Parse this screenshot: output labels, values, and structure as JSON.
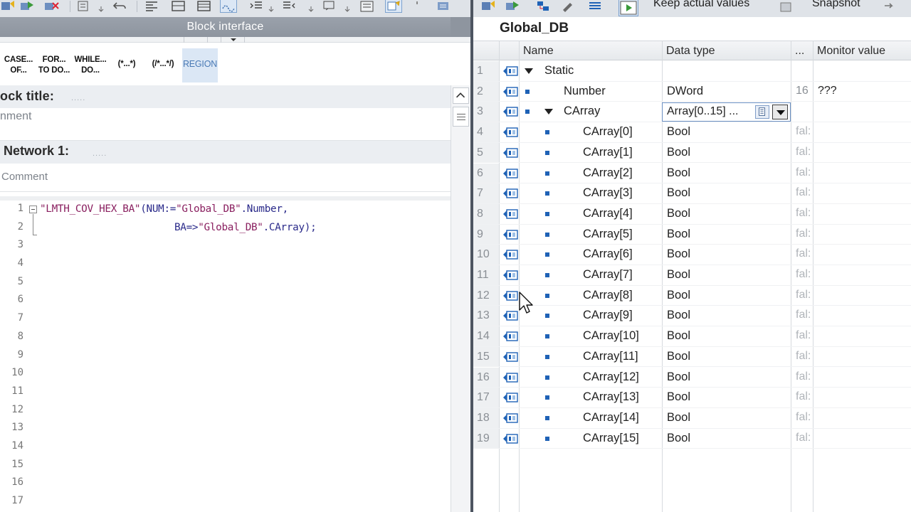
{
  "left_pane": {
    "block_interface_label": "Block interface",
    "instructions": [
      {
        "line1": "CASE...",
        "line2": "OF..."
      },
      {
        "line1": "FOR...",
        "line2": "TO DO..."
      },
      {
        "line1": "WHILE...",
        "line2": "DO..."
      },
      {
        "line1": "(*...*)",
        "line2": ""
      },
      {
        "line1": "(/*...*/)",
        "line2": ""
      },
      {
        "line1": "REGION",
        "line2": ""
      }
    ],
    "block_title_label": "ock title:",
    "block_title_dots": ".....",
    "block_comment_placeholder": "nment",
    "network_label": "Network 1:",
    "network_dots": ".....",
    "network_comment_placeholder": "Comment",
    "code_lines": [
      {
        "num": "1",
        "segments": [
          {
            "text": "\"LMTH_COV_HEX_BA\"",
            "kind": "str"
          },
          {
            "text": "(NUM:=",
            "kind": "op"
          },
          {
            "text": "\"Global_DB\"",
            "kind": "str"
          },
          {
            "text": ".Number,",
            "kind": "op"
          }
        ]
      },
      {
        "num": "2",
        "segments": [
          {
            "text": "BA=>",
            "kind": "op"
          },
          {
            "text": "\"Global_DB\"",
            "kind": "str"
          },
          {
            "text": ".CArray);",
            "kind": "op"
          }
        ]
      },
      {
        "num": "3",
        "segments": []
      },
      {
        "num": "4",
        "segments": []
      },
      {
        "num": "5",
        "segments": []
      },
      {
        "num": "6",
        "segments": []
      },
      {
        "num": "7",
        "segments": []
      },
      {
        "num": "8",
        "segments": []
      },
      {
        "num": "9",
        "segments": []
      },
      {
        "num": "10",
        "segments": []
      },
      {
        "num": "11",
        "segments": []
      },
      {
        "num": "12",
        "segments": []
      },
      {
        "num": "13",
        "segments": []
      },
      {
        "num": "14",
        "segments": []
      },
      {
        "num": "15",
        "segments": []
      },
      {
        "num": "16",
        "segments": []
      },
      {
        "num": "17",
        "segments": []
      }
    ]
  },
  "right_pane": {
    "toolbar": {
      "keep_actual_values": "Keep actual values",
      "snapshot": "Snapshot"
    },
    "db_title": "Global_DB",
    "columns": {
      "name": "Name",
      "data_type": "Data type",
      "ellipsis": "...",
      "monitor_value": "Monitor value"
    },
    "rows": [
      {
        "num": "1",
        "name": "Static",
        "indent": 0,
        "expander": true,
        "bullet": false,
        "data_type": "",
        "dots": "",
        "monitor": ""
      },
      {
        "num": "2",
        "name": "Number",
        "indent": 1,
        "expander": false,
        "bullet": true,
        "data_type": "DWord",
        "dots": "16",
        "monitor": "???"
      },
      {
        "num": "3",
        "name": "CArray",
        "indent": 1,
        "expander": true,
        "bullet": true,
        "data_type": "Array[0..15] ...",
        "dots": "",
        "monitor": "",
        "editing": true
      },
      {
        "num": "4",
        "name": "CArray[0]",
        "indent": 2,
        "expander": false,
        "bullet": true,
        "data_type": "Bool",
        "dots": "fal:",
        "monitor": ""
      },
      {
        "num": "5",
        "name": "CArray[1]",
        "indent": 2,
        "expander": false,
        "bullet": true,
        "data_type": "Bool",
        "dots": "fal:",
        "monitor": ""
      },
      {
        "num": "6",
        "name": "CArray[2]",
        "indent": 2,
        "expander": false,
        "bullet": true,
        "data_type": "Bool",
        "dots": "fal:",
        "monitor": ""
      },
      {
        "num": "7",
        "name": "CArray[3]",
        "indent": 2,
        "expander": false,
        "bullet": true,
        "data_type": "Bool",
        "dots": "fal:",
        "monitor": ""
      },
      {
        "num": "8",
        "name": "CArray[4]",
        "indent": 2,
        "expander": false,
        "bullet": true,
        "data_type": "Bool",
        "dots": "fal:",
        "monitor": ""
      },
      {
        "num": "9",
        "name": "CArray[5]",
        "indent": 2,
        "expander": false,
        "bullet": true,
        "data_type": "Bool",
        "dots": "fal:",
        "monitor": ""
      },
      {
        "num": "10",
        "name": "CArray[6]",
        "indent": 2,
        "expander": false,
        "bullet": true,
        "data_type": "Bool",
        "dots": "fal:",
        "monitor": ""
      },
      {
        "num": "11",
        "name": "CArray[7]",
        "indent": 2,
        "expander": false,
        "bullet": true,
        "data_type": "Bool",
        "dots": "fal:",
        "monitor": ""
      },
      {
        "num": "12",
        "name": "CArray[8]",
        "indent": 2,
        "expander": false,
        "bullet": true,
        "data_type": "Bool",
        "dots": "fal:",
        "monitor": ""
      },
      {
        "num": "13",
        "name": "CArray[9]",
        "indent": 2,
        "expander": false,
        "bullet": true,
        "data_type": "Bool",
        "dots": "fal:",
        "monitor": ""
      },
      {
        "num": "14",
        "name": "CArray[10]",
        "indent": 2,
        "expander": false,
        "bullet": true,
        "data_type": "Bool",
        "dots": "fal:",
        "monitor": ""
      },
      {
        "num": "15",
        "name": "CArray[11]",
        "indent": 2,
        "expander": false,
        "bullet": true,
        "data_type": "Bool",
        "dots": "fal:",
        "monitor": ""
      },
      {
        "num": "16",
        "name": "CArray[12]",
        "indent": 2,
        "expander": false,
        "bullet": true,
        "data_type": "Bool",
        "dots": "fal:",
        "monitor": ""
      },
      {
        "num": "17",
        "name": "CArray[13]",
        "indent": 2,
        "expander": false,
        "bullet": true,
        "data_type": "Bool",
        "dots": "fal:",
        "monitor": ""
      },
      {
        "num": "18",
        "name": "CArray[14]",
        "indent": 2,
        "expander": false,
        "bullet": true,
        "data_type": "Bool",
        "dots": "fal:",
        "monitor": ""
      },
      {
        "num": "19",
        "name": "CArray[15]",
        "indent": 2,
        "expander": false,
        "bullet": true,
        "data_type": "Bool",
        "dots": "fal:",
        "monitor": ""
      }
    ]
  },
  "colors": {
    "accent_blue": "#1f62b6",
    "header_gray": "#8e959f",
    "divider": "#4d5561"
  }
}
